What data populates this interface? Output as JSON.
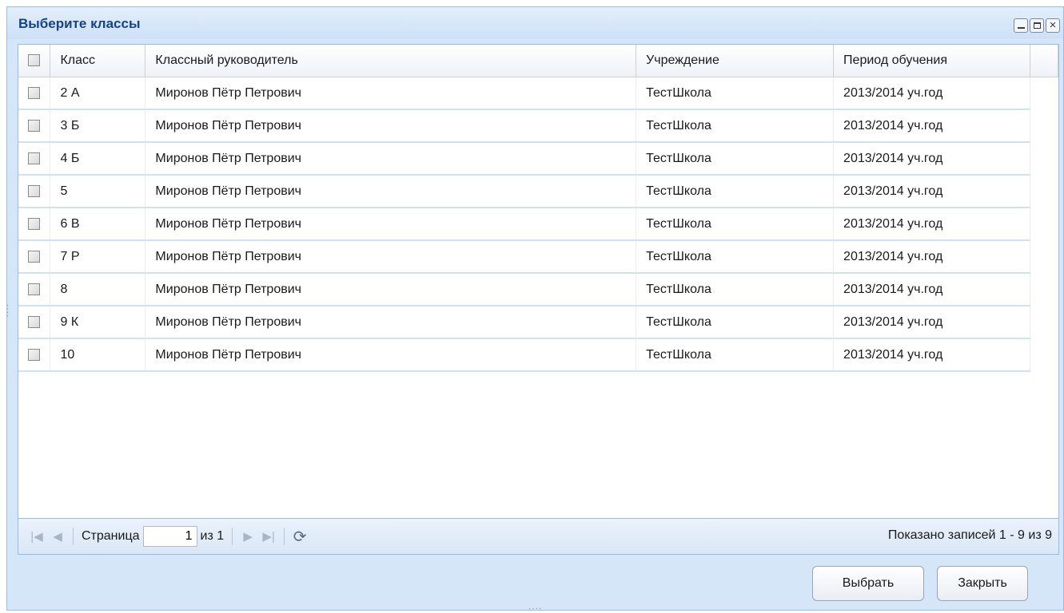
{
  "window": {
    "title": "Выберите классы",
    "tool_icons": [
      "minimize-icon",
      "maximize-icon",
      "close-icon"
    ]
  },
  "grid": {
    "columns": [
      "Класс",
      "Классный руководитель",
      "Учреждение",
      "Период обучения"
    ],
    "rows": [
      {
        "class": "2 А",
        "teacher": "Миронов Пётр Петрович",
        "school": "ТестШкола",
        "period": "2013/2014 уч.год"
      },
      {
        "class": "3 Б",
        "teacher": "Миронов Пётр Петрович",
        "school": "ТестШкола",
        "period": "2013/2014 уч.год"
      },
      {
        "class": "4 Б",
        "teacher": "Миронов Пётр Петрович",
        "school": "ТестШкола",
        "period": "2013/2014 уч.год"
      },
      {
        "class": "5",
        "teacher": "Миронов Пётр Петрович",
        "school": "ТестШкола",
        "period": "2013/2014 уч.год"
      },
      {
        "class": "6 В",
        "teacher": "Миронов Пётр Петрович",
        "school": "ТестШкола",
        "period": "2013/2014 уч.год"
      },
      {
        "class": "7 Р",
        "teacher": "Миронов Пётр Петрович",
        "school": "ТестШкола",
        "period": "2013/2014 уч.год"
      },
      {
        "class": "8",
        "teacher": "Миронов Пётр Петрович",
        "school": "ТестШкола",
        "period": "2013/2014 уч.год"
      },
      {
        "class": "9 К",
        "teacher": "Миронов Пётр Петрович",
        "school": "ТестШкола",
        "period": "2013/2014 уч.год"
      },
      {
        "class": "10",
        "teacher": "Миронов Пётр Петрович",
        "school": "ТестШкола",
        "period": "2013/2014 уч.год"
      }
    ]
  },
  "paging": {
    "page_label": "Страница",
    "page_value": "1",
    "of_label": "из 1",
    "count_text": "Показано записей 1 - 9 из 9"
  },
  "buttons": {
    "select": "Выбрать",
    "close": "Закрыть"
  },
  "colors": {
    "accent": "#15428b",
    "window_bg": "#d4e6f8",
    "border": "#99bbe8",
    "row_line": "#cfe3f7"
  }
}
